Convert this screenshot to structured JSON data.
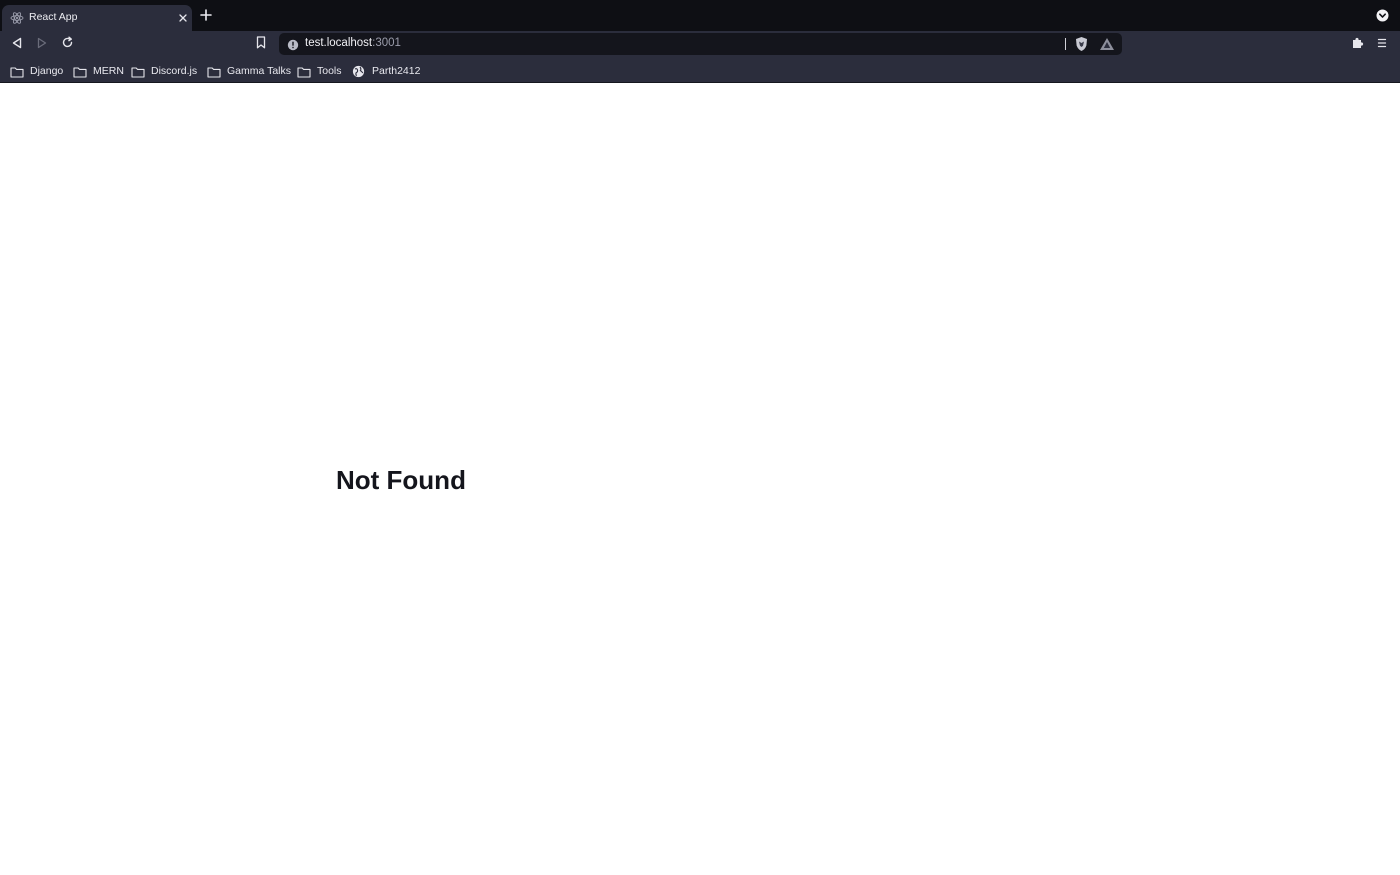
{
  "tab": {
    "title": "React App",
    "favicon": "react-icon",
    "close_icon": "close-icon"
  },
  "tabstrip": {
    "new_tab_icon": "plus-icon",
    "tab_search_icon": "chevron-down-circle-icon"
  },
  "toolbar": {
    "back_icon": "back-icon",
    "forward_icon": "forward-icon",
    "reload_icon": "reload-icon",
    "bookmark_icon": "bookmark-icon",
    "extensions_icon": "puzzle-icon",
    "menu_icon": "menu-icon"
  },
  "address": {
    "host": "test.localhost",
    "port": ":3001",
    "info_icon": "info-icon",
    "shield_icon": "brave-shield-icon",
    "rewards_icon": "brave-rewards-icon"
  },
  "bookmarks": [
    {
      "label": "Django",
      "icon": "folder-icon"
    },
    {
      "label": "MERN",
      "icon": "folder-icon"
    },
    {
      "label": "Discord.js",
      "icon": "folder-icon"
    },
    {
      "label": "Gamma Talks",
      "icon": "folder-icon"
    },
    {
      "label": "Tools",
      "icon": "folder-icon"
    },
    {
      "label": "Parth2412",
      "icon": "globe-icon"
    }
  ],
  "page": {
    "heading": "Not Found"
  },
  "colors": {
    "tabstrip_bg": "#0e0f14",
    "toolbar_bg": "#2b2d3c",
    "omnibox_bg": "#14151c",
    "page_bg": "#ffffff",
    "heading_text": "#14151c"
  }
}
